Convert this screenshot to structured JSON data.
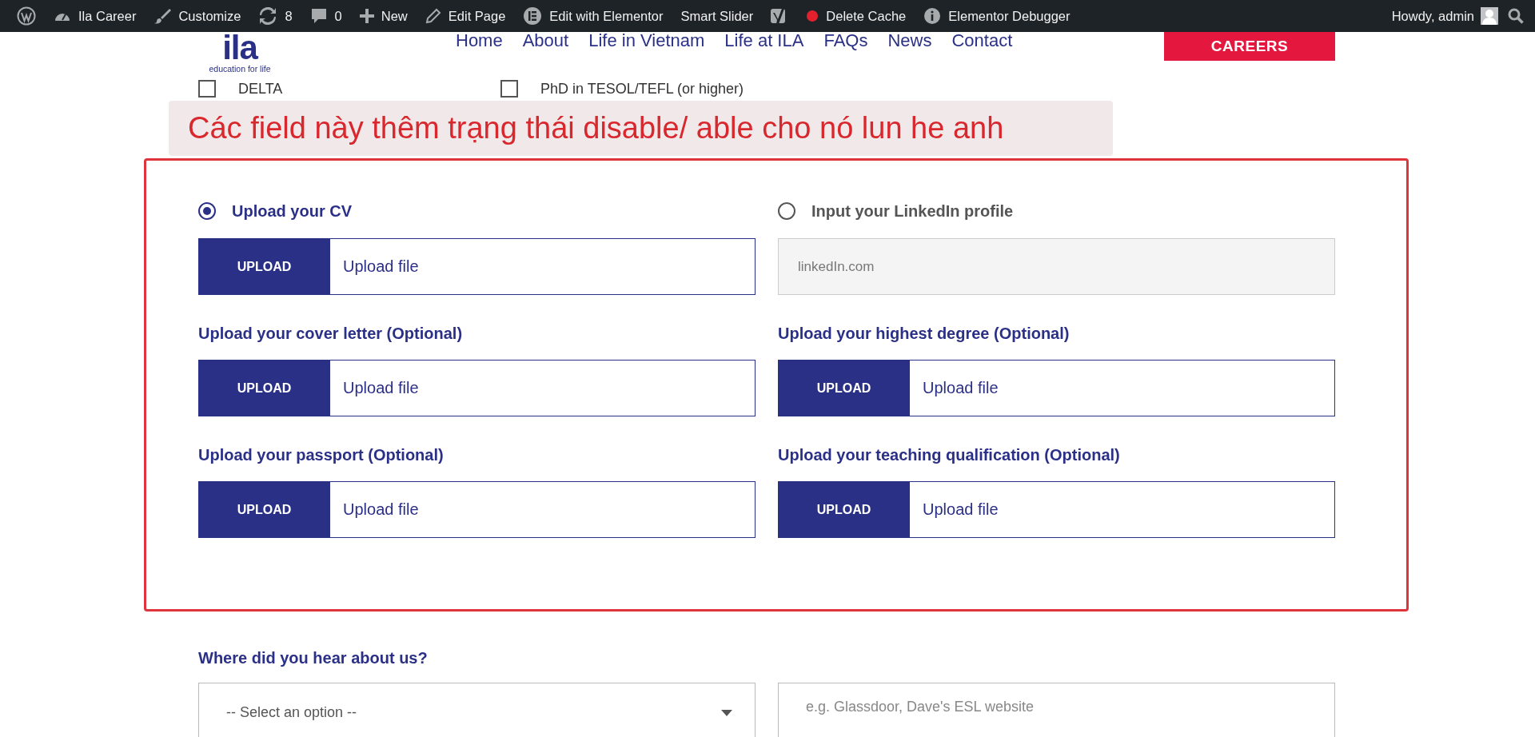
{
  "admin_bar": {
    "items": [
      {
        "kind": "wp-logo"
      },
      {
        "kind": "site",
        "label": "Ila Career"
      },
      {
        "kind": "customize",
        "label": "Customize"
      },
      {
        "kind": "updates",
        "label": "8"
      },
      {
        "kind": "comments",
        "label": "0"
      },
      {
        "kind": "new",
        "label": "New"
      },
      {
        "kind": "edit",
        "label": "Edit Page"
      },
      {
        "kind": "elementor",
        "label": "Edit with Elementor"
      },
      {
        "kind": "plain",
        "label": "Smart Slider"
      },
      {
        "kind": "yoast"
      },
      {
        "kind": "cache",
        "label": "Delete Cache"
      },
      {
        "kind": "info",
        "label": "Elementor Debugger"
      }
    ],
    "account": "Howdy, admin"
  },
  "header": {
    "logo_text": "ila",
    "tagline": "education for life",
    "nav": [
      "Home",
      "About",
      "Life in Vietnam",
      "Life at ILA",
      "FAQs",
      "News",
      "Contact"
    ],
    "cta": "CAREERS"
  },
  "qualifications": [
    {
      "label": "DELTA",
      "checked": false
    },
    {
      "label": "PhD in TESOL/TEFL (or higher)",
      "checked": false
    }
  ],
  "annotation": "Các field này thêm trạng thái disable/ able cho nó lun he anh",
  "upload_options": [
    {
      "label": "Upload your CV",
      "selected": true
    },
    {
      "label": "Input your LinkedIn profile",
      "selected": false
    }
  ],
  "cv_upload": {
    "button": "UPLOAD",
    "placeholder": "Upload file"
  },
  "linkedin": {
    "placeholder": "linkedIn.com",
    "disabled": true
  },
  "documents": [
    {
      "label": "Upload your cover letter (Optional)",
      "button": "UPLOAD",
      "placeholder": "Upload file"
    },
    {
      "label": "Upload your highest degree (Optional)",
      "button": "UPLOAD",
      "placeholder": "Upload file"
    },
    {
      "label": "Upload your passport (Optional)",
      "button": "UPLOAD",
      "placeholder": "Upload file"
    },
    {
      "label": "Upload your teaching qualification (Optional)",
      "button": "UPLOAD",
      "placeholder": "Upload file"
    }
  ],
  "referral": {
    "label": "Where did you hear about us?",
    "select_placeholder": "-- Select an option --",
    "other_placeholder": "e.g. Glassdoor, Dave's ESL website"
  }
}
